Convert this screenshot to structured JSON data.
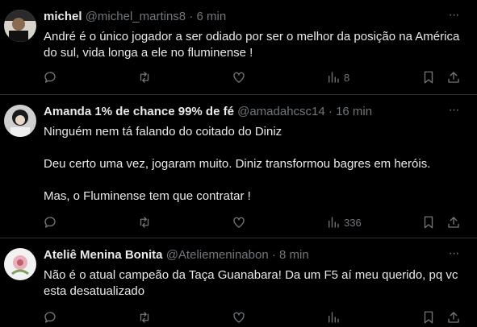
{
  "tweets": [
    {
      "name": "michel",
      "handle": "@michel_martins8",
      "time": "6 min",
      "paragraphs": [
        "André é o único jogador a ser odiado por  ser o melhor da posição na América do sul, vida longa a ele no fluminense !"
      ],
      "views": "8"
    },
    {
      "name": "Amanda 1% de chance 99% de fé",
      "handle": "@amadahcsc14",
      "time": "16 min",
      "paragraphs": [
        "Ninguém nem tá falando do coitado do Diniz",
        "Deu certo uma vez, jogaram muito. Diniz transformou bagres em heróis.",
        "Mas, o Fluminense tem que contratar !"
      ],
      "views": "336"
    },
    {
      "name": "Ateliê Menina Bonita",
      "handle": "@Ateliemeninabon",
      "time": "8 min",
      "paragraphs": [
        "Não é o atual campeão da Taça Guanabara! Da um F5 aí meu querido, pq vc esta desatualizado"
      ],
      "views": ""
    }
  ],
  "separator": "·",
  "more_glyph": "···",
  "colors": {
    "background": "#000000",
    "text": "#e7e9ea",
    "muted": "#71767b",
    "divider": "#2f3336"
  },
  "icons": [
    "reply-icon",
    "retweet-icon",
    "like-icon",
    "views-icon",
    "bookmark-icon",
    "share-icon",
    "more-icon"
  ]
}
